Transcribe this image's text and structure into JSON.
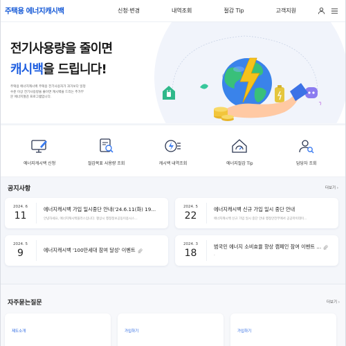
{
  "header": {
    "logo": "주택용 에너지캐시백",
    "nav": [
      "신청·변경",
      "내역조회",
      "절감 Tip",
      "고객지원"
    ],
    "icons": [
      "user-icon",
      "menu-icon"
    ]
  },
  "hero": {
    "title_line1": "전기사용량을 줄이면",
    "title_accent": "캐시백",
    "title_rest": "을 드립니다!",
    "description": "주택용 에너지캐시백 주택용 전기사용자가 과거보다 일정 수준 이상 전기사용량을 줄이면 캐시백을 드리는 추가부문 에너지절감 프로그램입니다."
  },
  "quick_menu": [
    {
      "label": "에너지캐시백 신청",
      "icon": "monitor-pen-icon"
    },
    {
      "label": "절감목표 사용량 조회",
      "icon": "document-search-icon"
    },
    {
      "label": "캐시백 내역조회",
      "icon": "coins-lightning-icon"
    },
    {
      "label": "에너지절감 Tip",
      "icon": "house-gauge-icon"
    },
    {
      "label": "담당자 조회",
      "icon": "person-search-icon"
    }
  ],
  "notice": {
    "title": "공지사항",
    "more": "더보기",
    "items": [
      {
        "ym": "2024. 6",
        "day": "11",
        "title": "에너지캐시백 가입 일시중단 안내('24.6.11(화) 19...",
        "sub": "안녕하세요, 에너지캐시백플러스입니다. 평상시 행정정보공동이용시스...",
        "attach": false
      },
      {
        "ym": "2024. 5",
        "day": "22",
        "title": "에너지캐시백 신규 가입 일시 중단 안내",
        "sub": "에너지캐시백 신규 가입 일시 중단 안내 행정안전부에서 공공마이데이...",
        "attach": false
      },
      {
        "ym": "2024. 5",
        "day": "9",
        "title": "에너지캐시백 '100만세대 참여 달성' 이벤트",
        "sub": "",
        "attach": true
      },
      {
        "ym": "2024. 3",
        "day": "18",
        "title": "범국민 에너지 소비효율 향상 캠페인 참여 이벤트 ...",
        "sub": "-",
        "attach": true
      }
    ]
  },
  "faq": {
    "title": "자주묻는질문",
    "more": "더보기",
    "items": [
      {
        "category": "제도소개"
      },
      {
        "category": "가입하기"
      },
      {
        "category": "가입하기"
      }
    ]
  },
  "colors": {
    "brand": "#1257d6",
    "accent": "#1f5fe0",
    "background": "#f4f6fa"
  }
}
